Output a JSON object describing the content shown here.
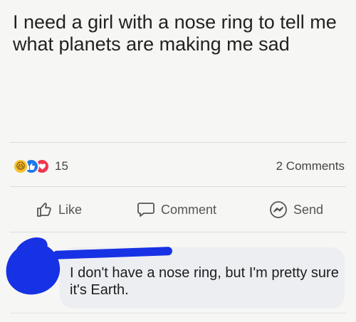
{
  "post": {
    "text": "I need a girl with a nose ring to tell me what planets are making me sad"
  },
  "reactions": {
    "icons": [
      "haha-icon",
      "like-icon",
      "love-icon"
    ],
    "count": "15"
  },
  "comments_count": "2 Comments",
  "actions": {
    "like_label": "Like",
    "comment_label": "Comment",
    "send_label": "Send"
  },
  "comment": {
    "text": "I don't have a nose ring, but I'm pretty sure it's Earth."
  },
  "colors": {
    "like_blue": "#1c76ee",
    "love_red": "#f0364f",
    "haha_yellow": "#f7c12f",
    "scribble_blue": "#1731e4"
  }
}
